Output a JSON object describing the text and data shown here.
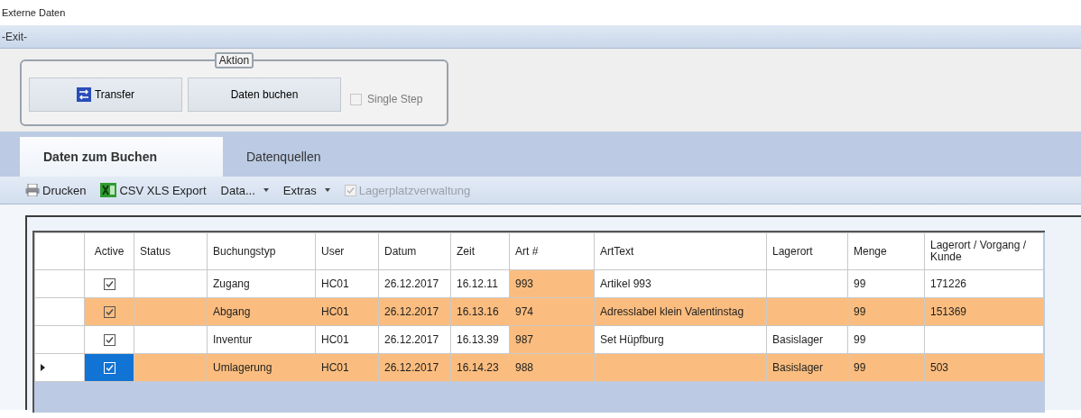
{
  "window": {
    "title": "Externe Daten"
  },
  "menu": [
    {
      "label": "-Exit-"
    }
  ],
  "action_group": {
    "title": "Aktion",
    "buttons": [
      {
        "label": "Transfer",
        "kind": "icon"
      },
      {
        "label": "Daten buchen",
        "kind": "plain"
      }
    ],
    "single_step": {
      "label": "Single Step",
      "checked": false,
      "disabled": true
    }
  },
  "tabs": [
    {
      "label": "Daten zum Buchen",
      "selected": true
    },
    {
      "label": "Datenquellen",
      "selected": false
    }
  ],
  "toolbar": [
    {
      "kind": "print",
      "label": "Drucken"
    },
    {
      "kind": "export",
      "label": "CSV XLS Export"
    },
    {
      "kind": "dropdown",
      "label": "Data..."
    },
    {
      "kind": "dropdown",
      "label": "Extras"
    },
    {
      "kind": "checkbox",
      "label": "Lagerplatzverwaltung",
      "checked": true,
      "disabled": true
    }
  ],
  "table": {
    "columns": [
      {
        "label": "Active",
        "highlighted": false
      },
      {
        "label": "Status",
        "highlighted": false
      },
      {
        "label": "Buchungstyp",
        "highlighted": false
      },
      {
        "label": "User",
        "highlighted": false
      },
      {
        "label": "Datum",
        "highlighted": false
      },
      {
        "label": "Zeit",
        "highlighted": false
      },
      {
        "label": "Art #",
        "highlighted": true
      },
      {
        "label": "ArtText",
        "highlighted": false
      },
      {
        "label": "Lagerort",
        "highlighted": false
      },
      {
        "label": "Menge",
        "highlighted": false
      },
      {
        "label": "Lagerort / Vorgang / Kunde",
        "highlighted": false
      }
    ],
    "rows": [
      {
        "selected": false,
        "highlighted": false,
        "cells": [
          {
            "kind": "checkbox",
            "checked": true
          },
          "",
          "Zugang",
          "HC01",
          "26.12.2017",
          "16.12.11",
          "993",
          "Artikel 993",
          "",
          "99",
          "171226"
        ]
      },
      {
        "selected": false,
        "highlighted": true,
        "cells": [
          {
            "kind": "checkbox",
            "checked": true
          },
          "",
          "Abgang",
          "HC01",
          "26.12.2017",
          "16.13.16",
          "974",
          "Adresslabel klein Valentinstag",
          "",
          "99",
          "151369"
        ]
      },
      {
        "selected": false,
        "highlighted": false,
        "cells": [
          {
            "kind": "checkbox",
            "checked": true
          },
          "",
          "Inventur",
          "HC01",
          "26.12.2017",
          "16.13.39",
          "987",
          "Set Hüpfburg",
          "Basislager",
          "99",
          ""
        ]
      },
      {
        "selected": true,
        "highlighted": true,
        "cells": [
          {
            "kind": "checkbox",
            "checked": true
          },
          "",
          "Umlagerung",
          "HC01",
          "26.12.2017",
          "16.14.23",
          "988",
          "",
          "Basislager",
          "99",
          "503"
        ]
      }
    ]
  }
}
